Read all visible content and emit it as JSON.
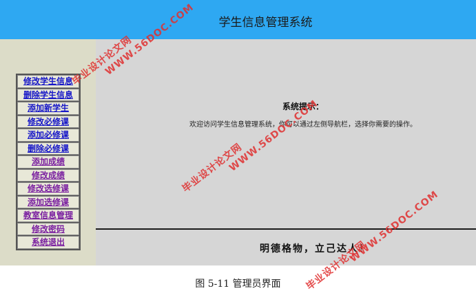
{
  "header": {
    "title": "学生信息管理系统",
    "color": "#2ea8f2"
  },
  "sidebar": {
    "items": [
      {
        "label": "修改学生信息"
      },
      {
        "label": "删除学生信息"
      },
      {
        "label": "添加新学生"
      },
      {
        "label": "修改必修课"
      },
      {
        "label": "添加必修课"
      },
      {
        "label": "删除必修课"
      },
      {
        "label": "添加成绩"
      },
      {
        "label": "修改成绩"
      },
      {
        "label": "修改选修课"
      },
      {
        "label": "添加选修课"
      },
      {
        "label": "教室信息管理"
      },
      {
        "label": "修改密码"
      },
      {
        "label": "系统退出"
      }
    ]
  },
  "main": {
    "tip_title": "系统提示：",
    "tip_text": "欢迎访问学生信息管理系统，你可以通过左侧导航栏，选择你需要的操作。",
    "motto": "明德格物，立己达人！"
  },
  "caption": "图 5-11 管理员界面",
  "watermark": {
    "site": "WWW.56DOC.COM",
    "cn": "毕业设计论文网",
    "color": "#e03030"
  }
}
